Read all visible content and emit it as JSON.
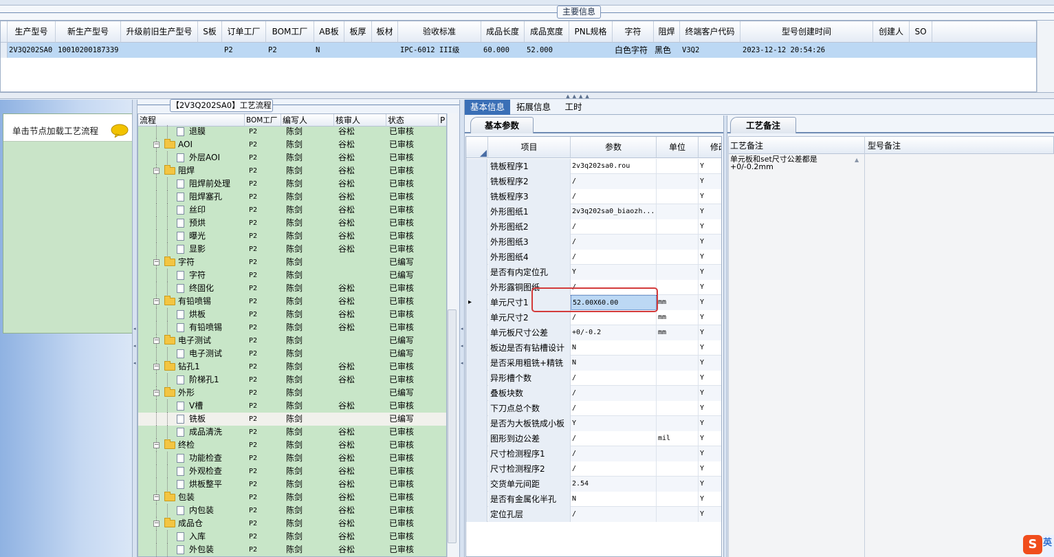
{
  "main_info": {
    "title": "主要信息",
    "columns": [
      "生产型号",
      "新生产型号",
      "升级前旧生产型号",
      "S板",
      "订单工厂",
      "BOM工厂",
      "AB板",
      "板厚",
      "板材",
      "验收标准",
      "成品长度",
      "成品宽度",
      "PNL规格",
      "字符",
      "阻焊",
      "终端客户代码",
      "型号创建时间",
      "创建人",
      "SO"
    ],
    "row": {
      "prod_model": "2V3Q202SA0",
      "new_prod_model": "10010200187339",
      "order_factory": "P2",
      "bom_factory": "P2",
      "ab_board": "N",
      "acceptance": "IPC-6012 III级",
      "length": "60.000",
      "width": "52.000",
      "char": "白色字符",
      "solder_mask": "黑色",
      "customer_code": "V3Q2",
      "created_time": "2023-12-12 20:54:26"
    }
  },
  "left_panel": {
    "hint": "单击节点加载工艺流程"
  },
  "process": {
    "title": "【2V3Q202SA0】工艺流程",
    "headers": [
      "流程",
      "BOM工厂",
      "编写人",
      "核审人",
      "状态",
      "P"
    ],
    "rows": [
      {
        "level": 2,
        "type": "doc",
        "name": "退膜",
        "bom": "P2",
        "writer": "陈剑",
        "reviewer": "谷松",
        "status": "已审核"
      },
      {
        "level": 1,
        "type": "folder",
        "name": "AOI",
        "bom": "P2",
        "writer": "陈剑",
        "reviewer": "谷松",
        "status": "已审核"
      },
      {
        "level": 2,
        "type": "doc",
        "name": "外层AOI",
        "bom": "P2",
        "writer": "陈剑",
        "reviewer": "谷松",
        "status": "已审核"
      },
      {
        "level": 1,
        "type": "folder",
        "name": "阻焊",
        "bom": "P2",
        "writer": "陈剑",
        "reviewer": "谷松",
        "status": "已审核"
      },
      {
        "level": 2,
        "type": "doc",
        "name": "阻焊前处理",
        "bom": "P2",
        "writer": "陈剑",
        "reviewer": "谷松",
        "status": "已审核"
      },
      {
        "level": 2,
        "type": "doc",
        "name": "阻焊塞孔",
        "bom": "P2",
        "writer": "陈剑",
        "reviewer": "谷松",
        "status": "已审核"
      },
      {
        "level": 2,
        "type": "doc",
        "name": "丝印",
        "bom": "P2",
        "writer": "陈剑",
        "reviewer": "谷松",
        "status": "已审核"
      },
      {
        "level": 2,
        "type": "doc",
        "name": "预烘",
        "bom": "P2",
        "writer": "陈剑",
        "reviewer": "谷松",
        "status": "已审核"
      },
      {
        "level": 2,
        "type": "doc",
        "name": "曝光",
        "bom": "P2",
        "writer": "陈剑",
        "reviewer": "谷松",
        "status": "已审核"
      },
      {
        "level": 2,
        "type": "doc",
        "name": "显影",
        "bom": "P2",
        "writer": "陈剑",
        "reviewer": "谷松",
        "status": "已审核"
      },
      {
        "level": 1,
        "type": "folder",
        "name": "字符",
        "bom": "P2",
        "writer": "陈剑",
        "reviewer": "",
        "status": "已编写"
      },
      {
        "level": 2,
        "type": "doc",
        "name": "字符",
        "bom": "P2",
        "writer": "陈剑",
        "reviewer": "",
        "status": "已编写"
      },
      {
        "level": 2,
        "type": "doc",
        "name": "终固化",
        "bom": "P2",
        "writer": "陈剑",
        "reviewer": "谷松",
        "status": "已审核"
      },
      {
        "level": 1,
        "type": "folder",
        "name": "有铅喷锡",
        "bom": "P2",
        "writer": "陈剑",
        "reviewer": "谷松",
        "status": "已审核"
      },
      {
        "level": 2,
        "type": "doc",
        "name": "烘板",
        "bom": "P2",
        "writer": "陈剑",
        "reviewer": "谷松",
        "status": "已审核"
      },
      {
        "level": 2,
        "type": "doc",
        "name": "有铅喷锡",
        "bom": "P2",
        "writer": "陈剑",
        "reviewer": "谷松",
        "status": "已审核"
      },
      {
        "level": 1,
        "type": "folder",
        "name": "电子测试",
        "bom": "P2",
        "writer": "陈剑",
        "reviewer": "",
        "status": "已编写"
      },
      {
        "level": 2,
        "type": "doc",
        "name": "电子测试",
        "bom": "P2",
        "writer": "陈剑",
        "reviewer": "",
        "status": "已编写"
      },
      {
        "level": 1,
        "type": "folder",
        "name": "钻孔1",
        "bom": "P2",
        "writer": "陈剑",
        "reviewer": "谷松",
        "status": "已审核"
      },
      {
        "level": 2,
        "type": "doc",
        "name": "阶梯孔1",
        "bom": "P2",
        "writer": "陈剑",
        "reviewer": "谷松",
        "status": "已审核"
      },
      {
        "level": 1,
        "type": "folder",
        "name": "外形",
        "bom": "P2",
        "writer": "陈剑",
        "reviewer": "",
        "status": "已编写"
      },
      {
        "level": 2,
        "type": "doc",
        "name": "V槽",
        "bom": "P2",
        "writer": "陈剑",
        "reviewer": "谷松",
        "status": "已审核"
      },
      {
        "level": 2,
        "type": "doc",
        "name": "铣板",
        "bom": "P2",
        "writer": "陈剑",
        "reviewer": "",
        "status": "已编写",
        "selected": true
      },
      {
        "level": 2,
        "type": "doc",
        "name": "成品清洗",
        "bom": "P2",
        "writer": "陈剑",
        "reviewer": "谷松",
        "status": "已审核"
      },
      {
        "level": 1,
        "type": "folder",
        "name": "终检",
        "bom": "P2",
        "writer": "陈剑",
        "reviewer": "谷松",
        "status": "已审核"
      },
      {
        "level": 2,
        "type": "doc",
        "name": "功能检查",
        "bom": "P2",
        "writer": "陈剑",
        "reviewer": "谷松",
        "status": "已审核"
      },
      {
        "level": 2,
        "type": "doc",
        "name": "外观检查",
        "bom": "P2",
        "writer": "陈剑",
        "reviewer": "谷松",
        "status": "已审核"
      },
      {
        "level": 2,
        "type": "doc",
        "name": "烘板整平",
        "bom": "P2",
        "writer": "陈剑",
        "reviewer": "谷松",
        "status": "已审核"
      },
      {
        "level": 1,
        "type": "folder",
        "name": "包装",
        "bom": "P2",
        "writer": "陈剑",
        "reviewer": "谷松",
        "status": "已审核"
      },
      {
        "level": 2,
        "type": "doc",
        "name": "内包装",
        "bom": "P2",
        "writer": "陈剑",
        "reviewer": "谷松",
        "status": "已审核"
      },
      {
        "level": 1,
        "type": "folder",
        "name": "成品仓",
        "bom": "P2",
        "writer": "陈剑",
        "reviewer": "谷松",
        "status": "已审核"
      },
      {
        "level": 2,
        "type": "doc",
        "name": "入库",
        "bom": "P2",
        "writer": "陈剑",
        "reviewer": "谷松",
        "status": "已审核"
      },
      {
        "level": 2,
        "type": "doc",
        "name": "外包装",
        "bom": "P2",
        "writer": "陈剑",
        "reviewer": "谷松",
        "status": "已审核"
      }
    ]
  },
  "tabs": {
    "basic": "基本信息",
    "ext": "拓展信息",
    "time": "工时"
  },
  "params": {
    "sub_tab": "基本参数",
    "headers": {
      "item": "项目",
      "param": "参数",
      "unit": "单位",
      "mod": "修改"
    },
    "rows": [
      {
        "name": "铣板程序1",
        "value": "2v3q202sa0.rou",
        "unit": "",
        "mod": "Y"
      },
      {
        "name": "铣板程序2",
        "value": "/",
        "unit": "",
        "mod": "Y"
      },
      {
        "name": "铣板程序3",
        "value": "/",
        "unit": "",
        "mod": "Y"
      },
      {
        "name": "外形图纸1",
        "value": "2v3q202sa0_biaozh...",
        "unit": "",
        "mod": "Y"
      },
      {
        "name": "外形图纸2",
        "value": "/",
        "unit": "",
        "mod": "Y"
      },
      {
        "name": "外形图纸3",
        "value": "/",
        "unit": "",
        "mod": "Y"
      },
      {
        "name": "外形图纸4",
        "value": "/",
        "unit": "",
        "mod": "Y"
      },
      {
        "name": "是否有内定位孔",
        "value": "Y",
        "unit": "",
        "mod": "Y"
      },
      {
        "name": "外形露铜图纸",
        "value": "/",
        "unit": "",
        "mod": "Y"
      },
      {
        "name": "单元尺寸1",
        "value": "52.00X60.00",
        "unit": "mm",
        "mod": "Y",
        "current": true
      },
      {
        "name": "单元尺寸2",
        "value": "/",
        "unit": "mm",
        "mod": "Y"
      },
      {
        "name": "单元板尺寸公差",
        "value": "+0/-0.2",
        "unit": "mm",
        "mod": "Y"
      },
      {
        "name": "板边是否有钻槽设计",
        "value": "N",
        "unit": "",
        "mod": "Y"
      },
      {
        "name": "是否采用粗铣+精铣",
        "value": "N",
        "unit": "",
        "mod": "Y"
      },
      {
        "name": "异形槽个数",
        "value": "/",
        "unit": "",
        "mod": "Y"
      },
      {
        "name": "叠板块数",
        "value": "/",
        "unit": "",
        "mod": "Y"
      },
      {
        "name": "下刀点总个数",
        "value": "/",
        "unit": "",
        "mod": "Y"
      },
      {
        "name": "是否为大板铣成小板",
        "value": "Y",
        "unit": "",
        "mod": "Y"
      },
      {
        "name": "图形到边公差",
        "value": "/",
        "unit": "mil",
        "mod": "Y"
      },
      {
        "name": "尺寸检测程序1",
        "value": "/",
        "unit": "",
        "mod": "Y"
      },
      {
        "name": "尺寸检测程序2",
        "value": "/",
        "unit": "",
        "mod": "Y"
      },
      {
        "name": "交货单元间距",
        "value": "2.54",
        "unit": "",
        "mod": "Y"
      },
      {
        "name": "是否有金属化半孔",
        "value": "N",
        "unit": "",
        "mod": "Y"
      },
      {
        "name": "定位孔层",
        "value": "/",
        "unit": "",
        "mod": "Y"
      }
    ]
  },
  "remarks": {
    "tab": "工艺备注",
    "craft_header": "工艺备注",
    "model_header": "型号备注",
    "craft_text": "单元板和set尺寸公差都是+0/-0.2mm"
  },
  "tray": {
    "sogou": "S",
    "side": "英"
  }
}
